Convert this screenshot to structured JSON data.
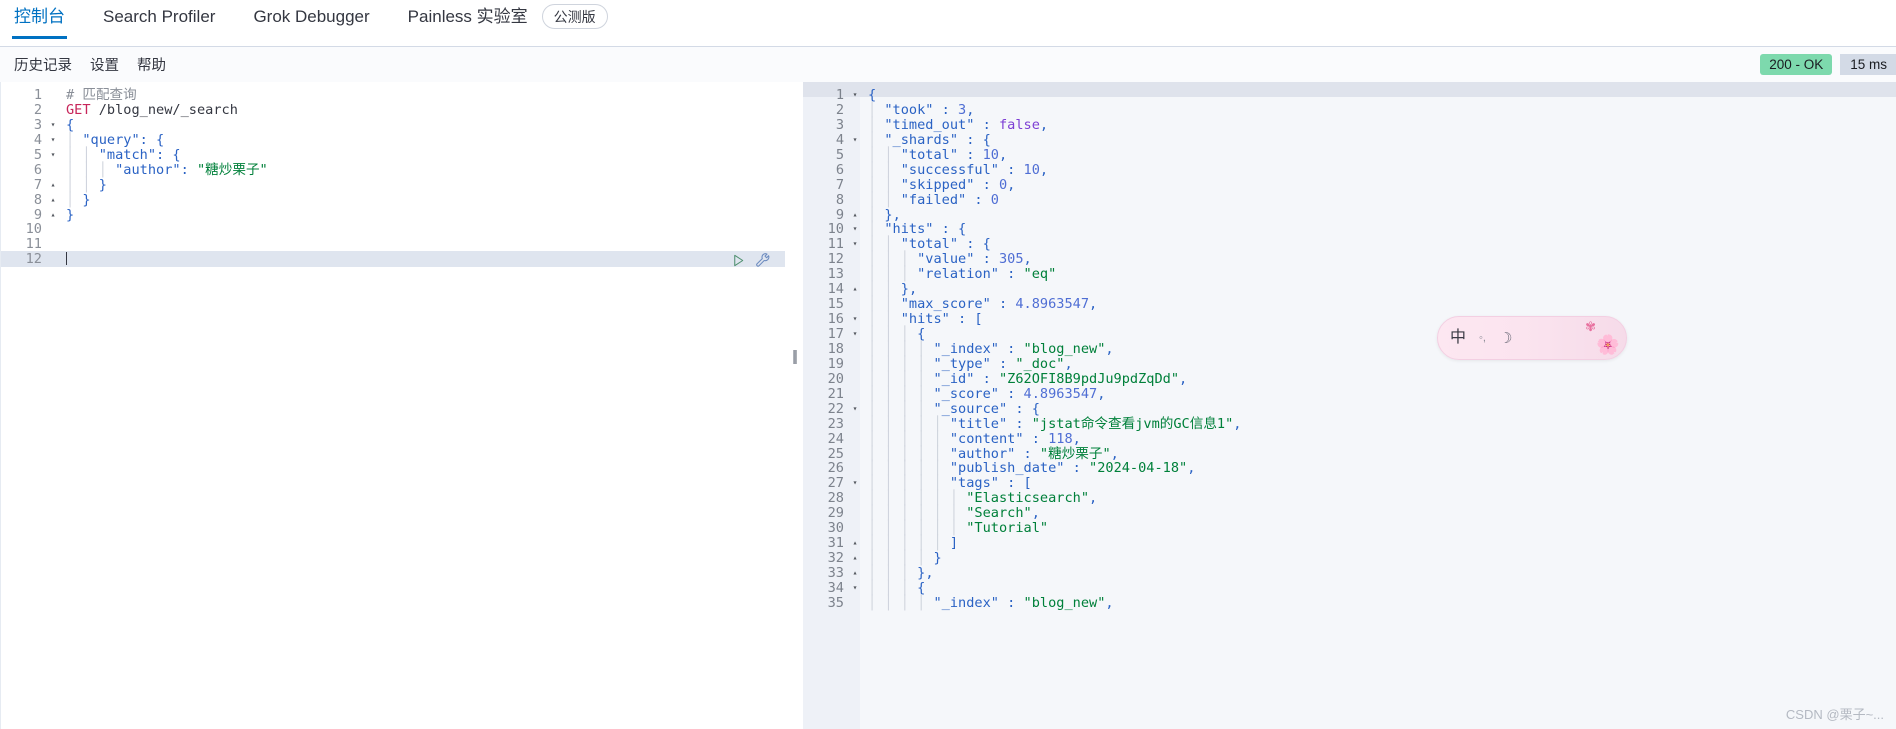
{
  "topnav": {
    "tabs": [
      {
        "label": "控制台",
        "active": true
      },
      {
        "label": "Search Profiler",
        "active": false
      },
      {
        "label": "Grok Debugger",
        "active": false
      },
      {
        "label": "Painless 实验室",
        "active": false
      }
    ],
    "beta_badge": "公测版"
  },
  "subnav": {
    "items": [
      {
        "label": "历史记录"
      },
      {
        "label": "设置"
      },
      {
        "label": "帮助"
      }
    ],
    "status": {
      "code_label": "200 - OK",
      "time_label": "15 ms",
      "ok_color": "#7dd9ad",
      "time_color": "#d3dae6"
    }
  },
  "request_editor": {
    "icons": {
      "run": "play-icon",
      "wrench": "wrench-icon"
    },
    "cursor_line": 12,
    "lines": [
      {
        "n": 1,
        "fold": "",
        "text": "# 匹配查询"
      },
      {
        "n": 2,
        "fold": "",
        "text": "GET /blog_new/_search"
      },
      {
        "n": 3,
        "fold": "▾",
        "text": "{"
      },
      {
        "n": 4,
        "fold": "▾",
        "text": "  \"query\": {"
      },
      {
        "n": 5,
        "fold": "▾",
        "text": "    \"match\": {"
      },
      {
        "n": 6,
        "fold": "",
        "text": "      \"author\": \"糖炒栗子\""
      },
      {
        "n": 7,
        "fold": "▴",
        "text": "    }"
      },
      {
        "n": 8,
        "fold": "▴",
        "text": "  }"
      },
      {
        "n": 9,
        "fold": "▴",
        "text": "}"
      },
      {
        "n": 10,
        "fold": "",
        "text": ""
      },
      {
        "n": 11,
        "fold": "",
        "text": ""
      },
      {
        "n": 12,
        "fold": "",
        "text": ""
      }
    ]
  },
  "response_editor": {
    "lines": [
      {
        "n": 1,
        "fold": "▾",
        "text": "{"
      },
      {
        "n": 2,
        "fold": "",
        "text": "  \"took\" : 3,"
      },
      {
        "n": 3,
        "fold": "",
        "text": "  \"timed_out\" : false,"
      },
      {
        "n": 4,
        "fold": "▾",
        "text": "  \"_shards\" : {"
      },
      {
        "n": 5,
        "fold": "",
        "text": "    \"total\" : 10,"
      },
      {
        "n": 6,
        "fold": "",
        "text": "    \"successful\" : 10,"
      },
      {
        "n": 7,
        "fold": "",
        "text": "    \"skipped\" : 0,"
      },
      {
        "n": 8,
        "fold": "",
        "text": "    \"failed\" : 0"
      },
      {
        "n": 9,
        "fold": "▴",
        "text": "  },"
      },
      {
        "n": 10,
        "fold": "▾",
        "text": "  \"hits\" : {"
      },
      {
        "n": 11,
        "fold": "▾",
        "text": "    \"total\" : {"
      },
      {
        "n": 12,
        "fold": "",
        "text": "      \"value\" : 305,"
      },
      {
        "n": 13,
        "fold": "",
        "text": "      \"relation\" : \"eq\""
      },
      {
        "n": 14,
        "fold": "▴",
        "text": "    },"
      },
      {
        "n": 15,
        "fold": "",
        "text": "    \"max_score\" : 4.8963547,"
      },
      {
        "n": 16,
        "fold": "▾",
        "text": "    \"hits\" : ["
      },
      {
        "n": 17,
        "fold": "▾",
        "text": "      {"
      },
      {
        "n": 18,
        "fold": "",
        "text": "        \"_index\" : \"blog_new\","
      },
      {
        "n": 19,
        "fold": "",
        "text": "        \"_type\" : \"_doc\","
      },
      {
        "n": 20,
        "fold": "",
        "text": "        \"_id\" : \"Z62OFI8B9pdJu9pdZqDd\","
      },
      {
        "n": 21,
        "fold": "",
        "text": "        \"_score\" : 4.8963547,"
      },
      {
        "n": 22,
        "fold": "▾",
        "text": "        \"_source\" : {"
      },
      {
        "n": 23,
        "fold": "",
        "text": "          \"title\" : \"jstat命令查看jvm的GC信息1\","
      },
      {
        "n": 24,
        "fold": "",
        "text": "          \"content\" : 118,"
      },
      {
        "n": 25,
        "fold": "",
        "text": "          \"author\" : \"糖炒栗子\","
      },
      {
        "n": 26,
        "fold": "",
        "text": "          \"publish_date\" : \"2024-04-18\","
      },
      {
        "n": 27,
        "fold": "▾",
        "text": "          \"tags\" : ["
      },
      {
        "n": 28,
        "fold": "",
        "text": "            \"Elasticsearch\","
      },
      {
        "n": 29,
        "fold": "",
        "text": "            \"Search\","
      },
      {
        "n": 30,
        "fold": "",
        "text": "            \"Tutorial\""
      },
      {
        "n": 31,
        "fold": "▴",
        "text": "          ]"
      },
      {
        "n": 32,
        "fold": "▴",
        "text": "        }"
      },
      {
        "n": 33,
        "fold": "▴",
        "text": "      },"
      },
      {
        "n": 34,
        "fold": "▾",
        "text": "      {"
      },
      {
        "n": 35,
        "fold": "",
        "text": "        \"_index\" : \"blog_new\","
      }
    ]
  },
  "splitter": {
    "label": "||"
  },
  "ime_widget": {
    "language_label": "中",
    "items": [
      "中",
      "◦",
      "☽",
      "❀"
    ]
  },
  "watermark": {
    "text": "CSDN @栗子~..."
  }
}
